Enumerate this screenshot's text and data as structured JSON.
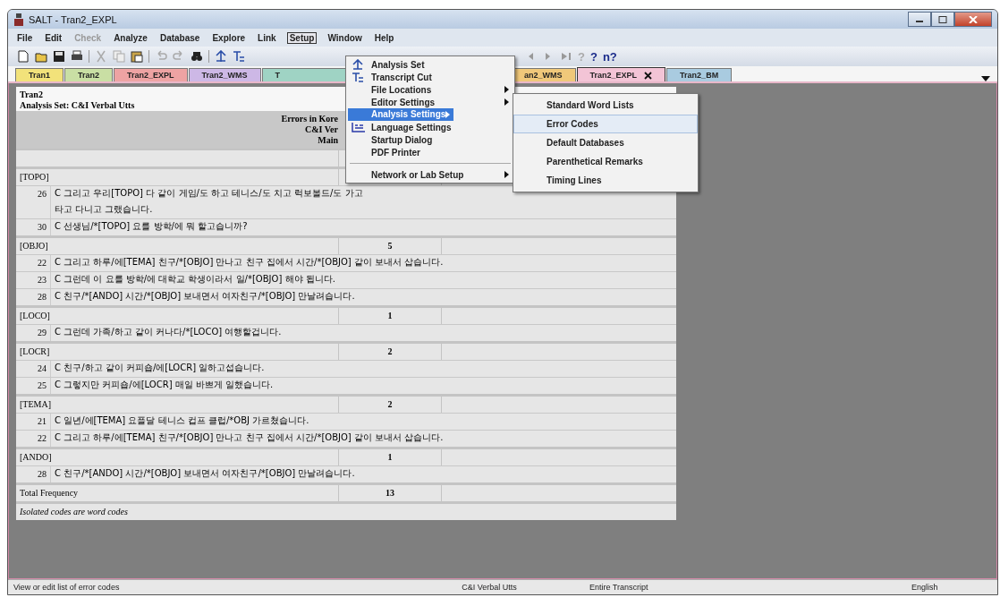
{
  "window": {
    "title": "SALT - Tran2_EXPL"
  },
  "menu_bar": [
    {
      "label": "File",
      "disabled": false,
      "selected": false
    },
    {
      "label": "Edit",
      "disabled": false,
      "selected": false
    },
    {
      "label": "Check",
      "disabled": true,
      "selected": false
    },
    {
      "label": "Analyze",
      "disabled": false,
      "selected": false
    },
    {
      "label": "Database",
      "disabled": false,
      "selected": false
    },
    {
      "label": "Explore",
      "disabled": false,
      "selected": false
    },
    {
      "label": "Link",
      "disabled": false,
      "selected": false
    },
    {
      "label": "Setup",
      "disabled": false,
      "selected": true
    },
    {
      "label": "Window",
      "disabled": false,
      "selected": false
    },
    {
      "label": "Help",
      "disabled": false,
      "selected": false
    }
  ],
  "toolbar": {
    "glyphs": [
      {
        "text": "?",
        "disabled": true
      },
      {
        "text": "?",
        "disabled": false
      },
      {
        "text": "n?",
        "disabled": false
      }
    ]
  },
  "tabs": [
    {
      "label": "Tran1",
      "color": "#f2e27a",
      "selected": false,
      "closable": false
    },
    {
      "label": "Tran2",
      "color": "#c9dfa4",
      "selected": false,
      "closable": false
    },
    {
      "label": "Tran2_EXPL",
      "color": "#eea3a3",
      "selected": false,
      "closable": false
    },
    {
      "label": "Tran2_WMS",
      "color": "#cdb8e6",
      "selected": false,
      "closable": false
    },
    {
      "label": "T",
      "color": "#9fd3c4",
      "selected": false,
      "closable": false
    },
    {
      "label": "an2_WMS",
      "color": "#f0c87a",
      "selected": false,
      "closable": false
    },
    {
      "label": "Tran2_EXPL",
      "color": "#f3c4d6",
      "selected": true,
      "closable": true
    },
    {
      "label": "Tran2_BM",
      "color": "#a9cbe0",
      "selected": false,
      "closable": false
    }
  ],
  "report": {
    "title": "Tran2",
    "subtitle": "Analysis Set: C&I Verbal Utts",
    "heading": [
      "Errors in Kore",
      "C&I Ver",
      "Main"
    ],
    "rows": [
      {
        "kind": "code",
        "code": "[TOPO]"
      },
      {
        "kind": "utt",
        "number": "26",
        "text": "C 그리고 우리[TOPO] 다 같이 게임/도 하고 테니스/도 치고 럭보볼드/도 가고 "
      },
      {
        "kind": "cont",
        "text": "타고 다니고 그랬습니다."
      },
      {
        "kind": "utt",
        "number": "30",
        "text": "C 선생님/*[TOPO] 요를 방학/에 뭐 할고습니까?"
      },
      {
        "kind": "code",
        "code": "[OBJO]",
        "count": "5"
      },
      {
        "kind": "utt",
        "number": "22",
        "text": "C 그리고 하루/에[TEMA] 친구/*[OBJO] 만나고 친구 집에서 시간/*[OBJO] 같이 보내서 삽습니다."
      },
      {
        "kind": "utt",
        "number": "23",
        "text": "C 그런데 이 요를 방학/에 대학교 학생이라서 일/*[OBJO] 해야 됩니다."
      },
      {
        "kind": "utt",
        "number": "28",
        "text": "C 친구/*[ANDO]  시간/*[OBJO] 보내면서 여자친구/*[OBJO] 만날려습니다."
      },
      {
        "kind": "code",
        "code": "[LOCO]",
        "count": "1"
      },
      {
        "kind": "utt",
        "number": "29",
        "text": "C 그런데 가족/하고 같이 커나다/*[LOCO] 여행할겁니다."
      },
      {
        "kind": "code",
        "code": "[LOCR]",
        "count": "2"
      },
      {
        "kind": "utt",
        "number": "24",
        "text": "C 친구/하고 같이 커피숍/에[LOCR] 일하고섭습니다."
      },
      {
        "kind": "utt",
        "number": "25",
        "text": "C 그렇지만 커피숍/에[LOCR] 매일 바쁘게 일했습니다."
      },
      {
        "kind": "code",
        "code": "[TEMA]",
        "count": "2"
      },
      {
        "kind": "utt",
        "number": "21",
        "text": "C 일년/에[TEMA] 요플달 테니스 컵프 클럽/*OBJ 가르쳤습니다."
      },
      {
        "kind": "utt",
        "number": "22",
        "text": "C 그리고 하루/에[TEMA] 친구/*[OBJO] 만나고 친구 집에서 시간/*[OBJO] 같이 보내서 삽습니다."
      },
      {
        "kind": "code",
        "code": "[ANDO]",
        "count": "1"
      },
      {
        "kind": "utt",
        "number": "28",
        "text": "C 친구/*[ANDO]  시간/*[OBJO] 보내면서 여자친구/*[OBJO] 만날려습니다."
      },
      {
        "kind": "total",
        "code": "Total Frequency",
        "count": "13"
      },
      {
        "kind": "note",
        "text": "Isolated codes are word codes"
      }
    ]
  },
  "setup_menu": [
    {
      "kind": "set",
      "label": "Analysis Set",
      "submenu": false,
      "selected": false
    },
    {
      "kind": "cut",
      "label": "Transcript Cut",
      "submenu": false,
      "selected": false
    },
    {
      "kind": "plain",
      "label": "File Locations",
      "submenu": true,
      "selected": false
    },
    {
      "kind": "plain",
      "label": "Editor Settings",
      "submenu": true,
      "selected": false
    },
    {
      "kind": "plain",
      "label": "Analysis Settings",
      "submenu": true,
      "selected": true
    },
    {
      "kind": "lang",
      "label": "Language Settings",
      "submenu": false,
      "selected": false
    },
    {
      "kind": "plain",
      "label": "Startup Dialog",
      "submenu": false,
      "selected": false
    },
    {
      "kind": "plain",
      "label": "PDF Printer",
      "submenu": false,
      "selected": false
    },
    {
      "kind": "separator"
    },
    {
      "kind": "plain",
      "label": "Network or Lab Setup",
      "submenu": true,
      "selected": false
    }
  ],
  "analysis_settings_menu": [
    {
      "label": "Standard Word Lists",
      "selected": false
    },
    {
      "label": "Error Codes",
      "selected": true
    },
    {
      "label": "Default Databases",
      "selected": false
    },
    {
      "label": "Parenthetical Remarks",
      "selected": false
    },
    {
      "label": "Timing Lines",
      "selected": false
    }
  ],
  "status_bar": [
    "View or edit list of error codes",
    "C&I Verbal Utts",
    "Entire Transcript",
    "English"
  ]
}
